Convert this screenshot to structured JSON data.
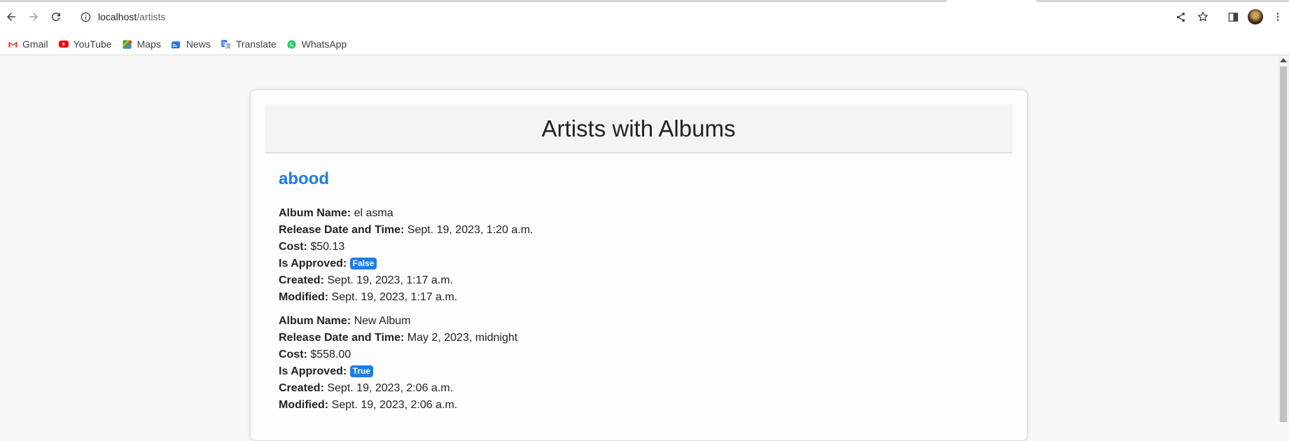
{
  "browser": {
    "url_host": "localhost",
    "url_path": "/artists",
    "bookmarks": [
      {
        "label": "Gmail",
        "icon": "gmail-icon"
      },
      {
        "label": "YouTube",
        "icon": "youtube-icon"
      },
      {
        "label": "Maps",
        "icon": "maps-icon"
      },
      {
        "label": "News",
        "icon": "news-icon"
      },
      {
        "label": "Translate",
        "icon": "translate-icon"
      },
      {
        "label": "WhatsApp",
        "icon": "whatsapp-icon"
      }
    ]
  },
  "page": {
    "title": "Artists with Albums",
    "artists": [
      {
        "name": "abood",
        "albums": [
          {
            "name_label": "Album Name:",
            "name": "el asma",
            "release_label": "Release Date and Time:",
            "release": "Sept. 19, 2023, 1:20 a.m.",
            "cost_label": "Cost:",
            "cost": "$50.13",
            "approved_label": "Is Approved:",
            "approved": "False",
            "created_label": "Created:",
            "created": "Sept. 19, 2023, 1:17 a.m.",
            "modified_label": "Modified:",
            "modified": "Sept. 19, 2023, 1:17 a.m."
          },
          {
            "name_label": "Album Name:",
            "name": "New Album",
            "release_label": "Release Date and Time:",
            "release": "May 2, 2023, midnight",
            "cost_label": "Cost:",
            "cost": "$558.00",
            "approved_label": "Is Approved:",
            "approved": "True",
            "created_label": "Created:",
            "created": "Sept. 19, 2023, 2:06 a.m.",
            "modified_label": "Modified:",
            "modified": "Sept. 19, 2023, 2:06 a.m."
          }
        ]
      }
    ]
  },
  "colors": {
    "link_blue": "#1a7ee6",
    "badge_blue": "#1a7ee6",
    "page_bg": "#f8f8f8"
  }
}
